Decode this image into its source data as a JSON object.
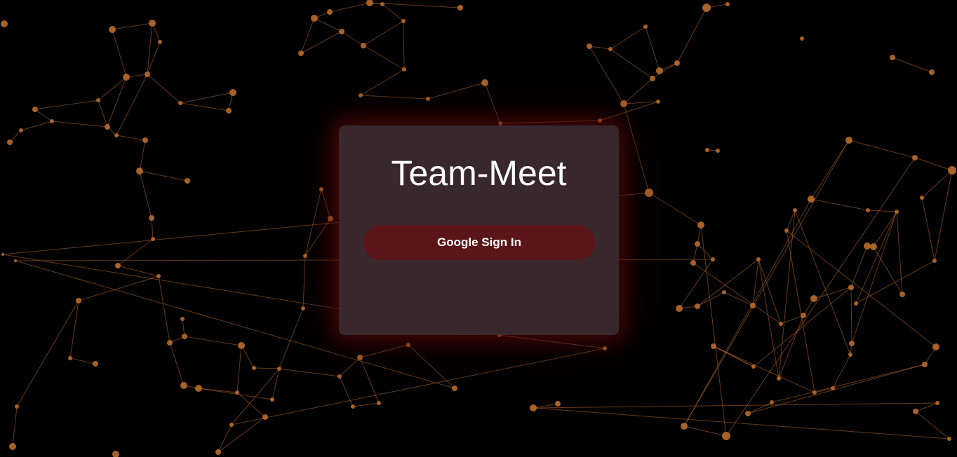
{
  "app": {
    "title": "Team-Meet"
  },
  "auth": {
    "google_signin_label": "Google Sign In"
  },
  "theme": {
    "background": "#000000",
    "network_color": "#b86a2c",
    "button_color": "#5a1518",
    "card_color": "#402c32"
  }
}
